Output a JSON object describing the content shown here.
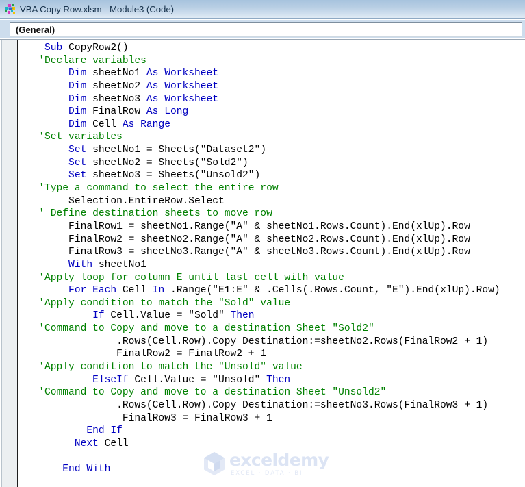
{
  "window": {
    "icon": "vba-module-icon",
    "title": "VBA Copy Row.xlsm - Module3 (Code)"
  },
  "toolbar": {
    "object_combo_value": "(General)",
    "object_combo_placeholder": "(General)"
  },
  "watermark": {
    "name": "exceldemy",
    "tagline": "EXCEL · DATA · BI"
  },
  "colors": {
    "keyword": "#0000C0",
    "comment": "#008000",
    "text": "#000000",
    "titlebar_top": "#A7C3DE",
    "titlebar_bottom": "#E2ECF6",
    "combo_strip": "#CDDDED",
    "margin_indicator": "#ECEFF1",
    "code_background": "#FFFFFF"
  },
  "code": {
    "language": "VBA",
    "lines": [
      [
        {
          "t": "kw",
          "s": "    Sub "
        },
        {
          "t": "txt",
          "s": "CopyRow2()"
        }
      ],
      [
        {
          "t": "cmt",
          "s": "   'Declare variables"
        }
      ],
      [
        {
          "t": "kw",
          "s": "        Dim "
        },
        {
          "t": "txt",
          "s": "sheetNo1 "
        },
        {
          "t": "kw",
          "s": "As "
        },
        {
          "t": "kw",
          "s": "Worksheet"
        }
      ],
      [
        {
          "t": "kw",
          "s": "        Dim "
        },
        {
          "t": "txt",
          "s": "sheetNo2 "
        },
        {
          "t": "kw",
          "s": "As "
        },
        {
          "t": "kw",
          "s": "Worksheet"
        }
      ],
      [
        {
          "t": "kw",
          "s": "        Dim "
        },
        {
          "t": "txt",
          "s": "sheetNo3 "
        },
        {
          "t": "kw",
          "s": "As "
        },
        {
          "t": "kw",
          "s": "Worksheet"
        }
      ],
      [
        {
          "t": "kw",
          "s": "        Dim "
        },
        {
          "t": "txt",
          "s": "FinalRow "
        },
        {
          "t": "kw",
          "s": "As "
        },
        {
          "t": "kw",
          "s": "Long"
        }
      ],
      [
        {
          "t": "kw",
          "s": "        Dim "
        },
        {
          "t": "txt",
          "s": "Cell "
        },
        {
          "t": "kw",
          "s": "As "
        },
        {
          "t": "kw",
          "s": "Range"
        }
      ],
      [
        {
          "t": "cmt",
          "s": "   'Set variables"
        }
      ],
      [
        {
          "t": "kw",
          "s": "        Set "
        },
        {
          "t": "txt",
          "s": "sheetNo1 = Sheets(\"Dataset2\")"
        }
      ],
      [
        {
          "t": "kw",
          "s": "        Set "
        },
        {
          "t": "txt",
          "s": "sheetNo2 = Sheets(\"Sold2\")"
        }
      ],
      [
        {
          "t": "kw",
          "s": "        Set "
        },
        {
          "t": "txt",
          "s": "sheetNo3 = Sheets(\"Unsold2\")"
        }
      ],
      [
        {
          "t": "cmt",
          "s": "   'Type a command to select the entire row"
        }
      ],
      [
        {
          "t": "txt",
          "s": "        Selection.EntireRow.Select"
        }
      ],
      [
        {
          "t": "cmt",
          "s": "   ' Define destination sheets to move row"
        }
      ],
      [
        {
          "t": "txt",
          "s": "        FinalRow1 = sheetNo1.Range(\"A\" & sheetNo1.Rows.Count).End(xlUp).Row"
        }
      ],
      [
        {
          "t": "txt",
          "s": "        FinalRow2 = sheetNo2.Range(\"A\" & sheetNo2.Rows.Count).End(xlUp).Row"
        }
      ],
      [
        {
          "t": "txt",
          "s": "        FinalRow3 = sheetNo3.Range(\"A\" & sheetNo3.Rows.Count).End(xlUp).Row"
        }
      ],
      [
        {
          "t": "kw",
          "s": "        With "
        },
        {
          "t": "txt",
          "s": "sheetNo1"
        }
      ],
      [
        {
          "t": "cmt",
          "s": "   'Apply loop for column E until last cell with value"
        }
      ],
      [
        {
          "t": "kw",
          "s": "        For Each "
        },
        {
          "t": "txt",
          "s": "Cell "
        },
        {
          "t": "kw",
          "s": "In "
        },
        {
          "t": "txt",
          "s": ".Range(\"E1:E\" & .Cells(.Rows.Count, \"E\").End(xlUp).Row)"
        }
      ],
      [
        {
          "t": "cmt",
          "s": "   'Apply condition to match the \"Sold\" value"
        }
      ],
      [
        {
          "t": "kw",
          "s": "            If "
        },
        {
          "t": "txt",
          "s": "Cell.Value = \"Sold\" "
        },
        {
          "t": "kw",
          "s": "Then"
        }
      ],
      [
        {
          "t": "cmt",
          "s": "   'Command to Copy and move to a destination Sheet \"Sold2\""
        }
      ],
      [
        {
          "t": "txt",
          "s": "                .Rows(Cell.Row).Copy Destination:=sheetNo2.Rows(FinalRow2 + 1)"
        }
      ],
      [
        {
          "t": "txt",
          "s": "                FinalRow2 = FinalRow2 + 1"
        }
      ],
      [
        {
          "t": "cmt",
          "s": "   'Apply condition to match the \"Unsold\" value"
        }
      ],
      [
        {
          "t": "kw",
          "s": "            ElseIf "
        },
        {
          "t": "txt",
          "s": "Cell.Value = \"Unsold\" "
        },
        {
          "t": "kw",
          "s": "Then"
        }
      ],
      [
        {
          "t": "cmt",
          "s": "   'Command to Copy and move to a destination Sheet \"Unsold2\""
        }
      ],
      [
        {
          "t": "txt",
          "s": "                .Rows(Cell.Row).Copy Destination:=sheetNo3.Rows(FinalRow3 + 1)"
        }
      ],
      [
        {
          "t": "txt",
          "s": "                 FinalRow3 = FinalRow3 + 1"
        }
      ],
      [
        {
          "t": "kw",
          "s": "           End If"
        }
      ],
      [
        {
          "t": "kw",
          "s": "         Next "
        },
        {
          "t": "txt",
          "s": "Cell"
        }
      ],
      [
        {
          "t": "txt",
          "s": ""
        }
      ],
      [
        {
          "t": "kw",
          "s": "       End With"
        }
      ]
    ]
  }
}
